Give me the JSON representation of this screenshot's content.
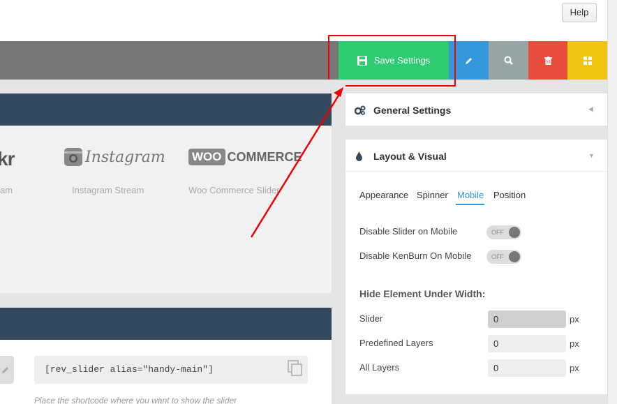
{
  "header": {
    "help_label": "Help"
  },
  "toolbar": {
    "save_label": "Save Settings",
    "accent_colors": {
      "save": "#2ecc71",
      "edit": "#3498db",
      "preview": "#95a5a6",
      "delete": "#e74c3c",
      "export": "#f1c40f"
    }
  },
  "sources": [
    {
      "logo": "kr",
      "label": "am"
    },
    {
      "logo": "Instagram",
      "label": "Instagram Stream"
    },
    {
      "logo_box": "WOO",
      "logo_text": "COMMERCE",
      "label": "Woo Commerce Slider"
    }
  ],
  "shortcode": {
    "value": "[rev_slider alias=\"handy-main\"]",
    "hint": "Place the shortcode where you want to show the slider"
  },
  "general_panel": {
    "title": "General Settings"
  },
  "layout_panel": {
    "title": "Layout & Visual",
    "tabs": [
      "Appearance",
      "Spinner",
      "Mobile",
      "Position"
    ],
    "active_tab": "Mobile",
    "options": [
      {
        "label": "Disable Slider on Mobile",
        "state": "OFF"
      },
      {
        "label": "Disable KenBurn On Mobile",
        "state": "OFF"
      }
    ],
    "hide_title": "Hide Element Under Width:",
    "widths": [
      {
        "label": "Slider",
        "value": "0",
        "unit": "px"
      },
      {
        "label": "Predefined Layers",
        "value": "0",
        "unit": "px"
      },
      {
        "label": "All Layers",
        "value": "0",
        "unit": "px"
      }
    ]
  }
}
